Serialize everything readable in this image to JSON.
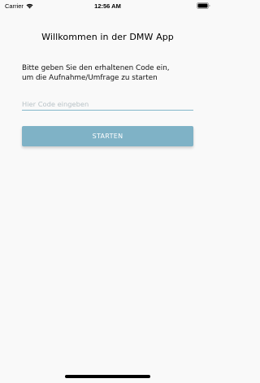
{
  "status_bar": {
    "carrier": "Carrier",
    "time": "12:56 AM",
    "wifi_icon": "wifi-icon",
    "battery_icon": "battery-icon"
  },
  "content": {
    "title": "Willkommen in der DMW App",
    "instruction": "Bitte geben Sie den erhaltenen Code ein,\num die Aufnahme/Umfrage zu starten",
    "code_input": {
      "placeholder": "Hier Code eingeben",
      "value": ""
    },
    "start_button_label": "STARTEN"
  },
  "colors": {
    "accent": "#7fb2c6",
    "input_underline": "#84b7cb",
    "background": "#f9f9f9"
  }
}
